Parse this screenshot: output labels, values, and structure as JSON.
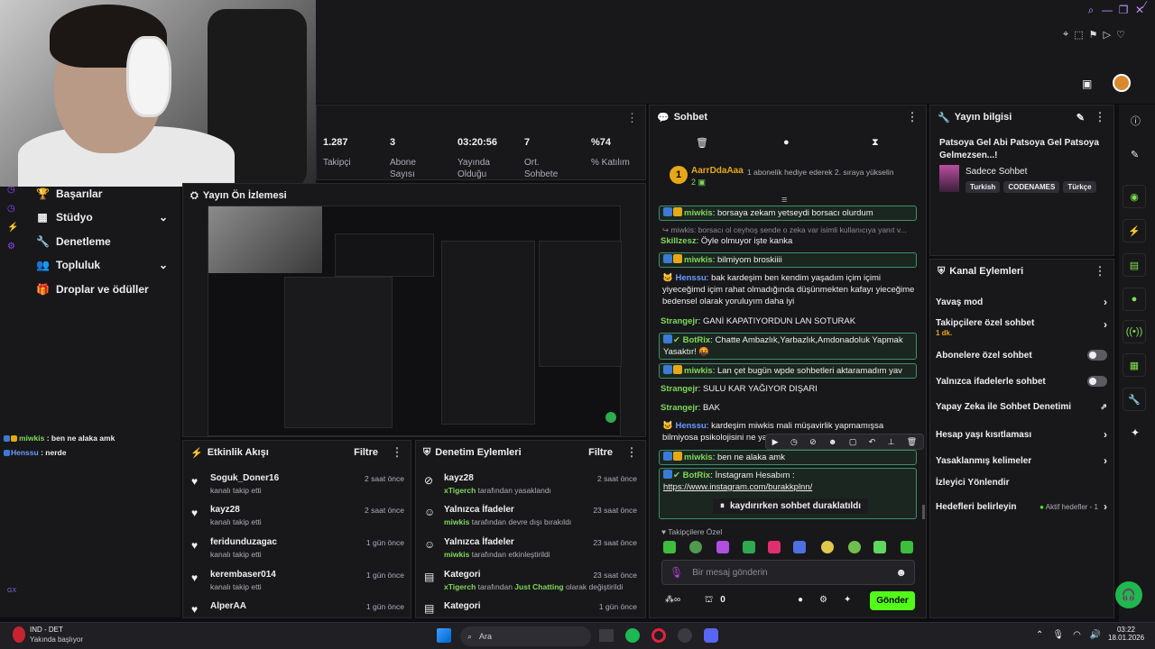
{
  "window_controls": [
    "search-icon",
    "minimize-icon",
    "restore-icon",
    "close-icon"
  ],
  "toolbar_icons": [
    "pin-icon",
    "crop-icon",
    "flag-icon",
    "play-icon",
    "heart-icon"
  ],
  "stats": [
    {
      "value": "1.287",
      "label": "Takipçi"
    },
    {
      "value": "3",
      "label": "Abone Sayısı"
    },
    {
      "value": "03:20:56",
      "label": "Yayında Olduğu"
    },
    {
      "value": "7",
      "label": "Ort. Sohbete"
    },
    {
      "value": "%74",
      "label": "% Katılım"
    }
  ],
  "nav": {
    "achievements": "Başarılar",
    "studio": "Stüdyo",
    "moderation": "Denetleme",
    "community": "Topluluk",
    "drops": "Droplar ve ödüller"
  },
  "overlay_chat": [
    {
      "user": "miwkis",
      "text": " : ben ne alaka amk"
    },
    {
      "user": "Henssu",
      "text": " : nerde"
    }
  ],
  "gx_label": "GX",
  "preview": {
    "title": "Yayın Ön İzlemesi"
  },
  "activity": {
    "title": "Etkinlik Akışı",
    "filter": "Filtre",
    "items": [
      {
        "name": "Soguk_Doner16",
        "sub": "kanalı takip etti",
        "time": "2 saat önce"
      },
      {
        "name": "kayz28",
        "sub": "kanalı takip etti",
        "time": "2 saat önce"
      },
      {
        "name": "feridunduzagac",
        "sub": "kanalı takip etti",
        "time": "1 gün önce"
      },
      {
        "name": "kerembaser014",
        "sub": "kanalı takip etti",
        "time": "1 gün önce"
      },
      {
        "name": "AlperAA",
        "sub": "",
        "time": "1 gün önce"
      }
    ]
  },
  "moderation": {
    "title": "Denetim Eylemleri",
    "filter": "Filtre",
    "items": [
      {
        "name": "kayz28",
        "who": "xTigerch",
        "rest": " tarafından yasaklandı",
        "time": "2 saat önce"
      },
      {
        "name": "Yalnızca İfadeler",
        "who": "miwkis",
        "rest": " tarafından devre dışı bırakıldı",
        "time": "23 saat önce"
      },
      {
        "name": "Yalnızca İfadeler",
        "who": "miwkis",
        "rest": " tarafından etkinleştirildi",
        "time": "23 saat önce"
      },
      {
        "name": "Kategori",
        "who": "xTigerch",
        "rest": " tarafından ",
        "extra": "Just Chatting",
        "rest2": " olarak değiştirildi",
        "time": "23 saat önce"
      },
      {
        "name": "Kategori",
        "who": "",
        "rest": "",
        "time": "1 gün önce"
      }
    ]
  },
  "chat": {
    "title": "Sohbet",
    "top_user": "AarrDdaAaa",
    "top_count": "2",
    "top_msg": "1 abonelik hediye ederek 2. sıraya yükselin",
    "messages": [
      {
        "user": "miwkis",
        "text": ": borsaya zekam yetseydi borsacı olurdum"
      },
      {
        "user": "",
        "text": "miwkis: borsacı ol ceyhoş sende o zeka var isimli kullanıcıya yanıt v..."
      },
      {
        "user": "Skillzesz",
        "text": ": Öyle olmuyor işte kanka"
      },
      {
        "user": "miwkis",
        "text": ": bilmiyom broskiiii"
      },
      {
        "user": "Henssu",
        "text": ": bak kardeşim ben kendim yaşadım içim içimi yiyeceğimd içim rahat olmadığında düşünmekten kafayı yieceğime bedensel olarak yoruluyım daha iyi"
      },
      {
        "user": "Strangejr",
        "text": ": GANİ KAPATIYORDUN LAN SOTURAK"
      },
      {
        "user": "BotRix",
        "text": ": Chatte Ambazlık,Yarbazlık,Amdonadoluk Yapmak Yasaktır! 🤬"
      },
      {
        "user": "miwkis",
        "text": ": Lan çet bugün wpde sohbetleri aktaramadım yav"
      },
      {
        "user": "Strangejr",
        "text": ": SULU KAR YAĞIYOR DIŞARI"
      },
      {
        "user": "Strangejr",
        "text": ": BAK"
      },
      {
        "user": "Henssu",
        "text": ": kardeşim miwkis mali müşavirlik yapmamışsa bilmiyosa psikolojisini ne yapayım"
      },
      {
        "user": "miwkis",
        "text": ": ben ne alaka amk"
      },
      {
        "user": "BotRix",
        "text": ": İnstagram Hesabım :"
      },
      {
        "user": "",
        "text": "https://www.instagram.com/burakkplnn/"
      }
    ],
    "paused": "kaydırırken sohbet duraklatıldı",
    "followers_only": "Takipçilere Özel",
    "input_placeholder": "Bir mesaj gönderin",
    "points": "0",
    "send": "Gönder"
  },
  "stream_info": {
    "title": "Yayın bilgisi",
    "stream_title": "Patsoya Gel Abi Patsoya Gel Patsoya Gelmezsen...!",
    "category": "Sadece Sohbet",
    "tags": [
      "Turkish",
      "CODENAMES",
      "Türkçe"
    ]
  },
  "channel_actions": {
    "title": "Kanal Eylemleri",
    "slow": "Yavaş mod",
    "followers": "Takipçilere özel sohbet",
    "followers_sub": "1 dk.",
    "subs": "Abonelere özel sohbet",
    "emotes": "Yalnızca ifadelerle sohbet",
    "ai": "Yapay Zeka ile Sohbet Denetimi",
    "age": "Hesap yaşı kısıtlaması",
    "banned": "Yasaklanmış kelimeler",
    "redirect": "İzleyici Yönlendir",
    "goals": "Hedefleri belirleyin",
    "goals_sub": "Aktif hedefler - 1"
  },
  "taskbar": {
    "weather_title": "IND - DET",
    "weather_sub": "Yakında başlıyor",
    "search": "Ara",
    "time": "03:22",
    "date": "18.01.2026"
  }
}
